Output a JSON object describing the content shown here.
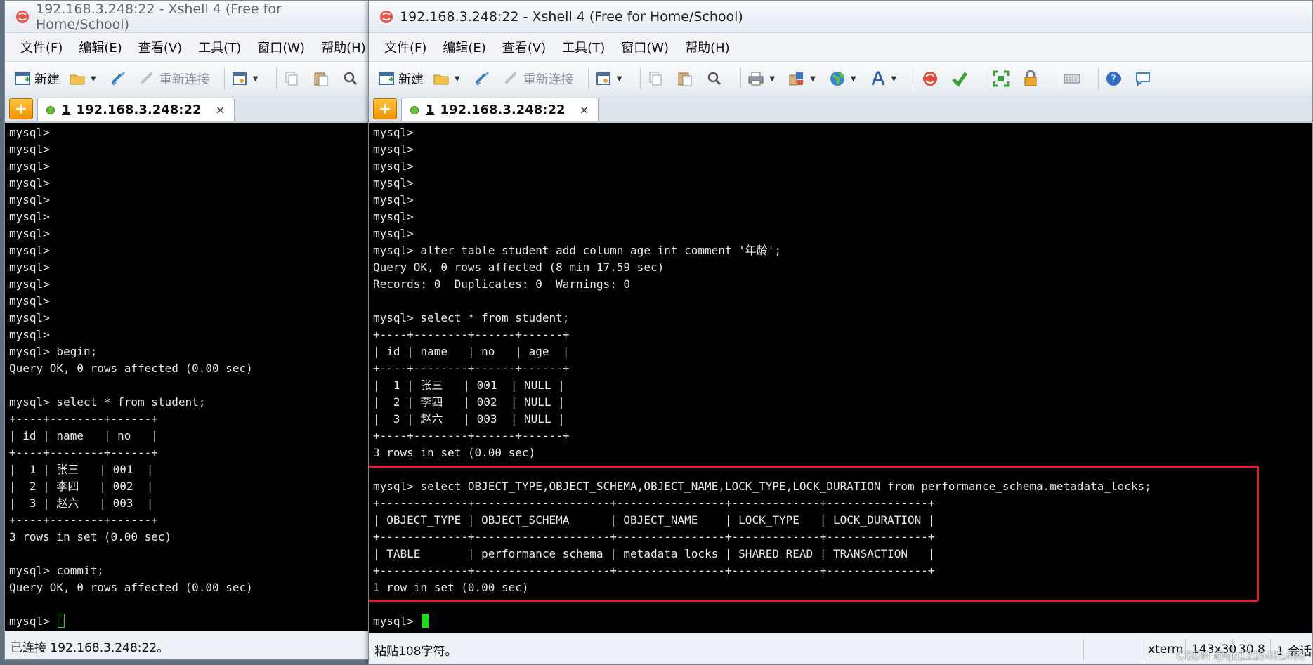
{
  "left_window": {
    "title": "192.168.3.248:22 - Xshell 4 (Free for Home/School)",
    "menu": [
      "文件(F)",
      "编辑(E)",
      "查看(V)",
      "工具(T)",
      "窗口(W)",
      "帮助(H)"
    ],
    "toolbar": {
      "new_label": "新建",
      "reconnect_label": "重新连接"
    },
    "tab": {
      "number": "1",
      "label": "192.168.3.248:22",
      "close": "×",
      "add": "+"
    },
    "terminal_lines": [
      "mysql>",
      "mysql>",
      "mysql>",
      "mysql>",
      "mysql>",
      "mysql>",
      "mysql>",
      "mysql>",
      "mysql>",
      "mysql>",
      "mysql>",
      "mysql>",
      "mysql>",
      "mysql> begin;",
      "Query OK, 0 rows affected (0.00 sec)",
      "",
      "mysql> select * from student;",
      "+----+--------+------+",
      "| id | name   | no   |",
      "+----+--------+------+",
      "|  1 | 张三   | 001  |",
      "|  2 | 李四   | 002  |",
      "|  3 | 赵六   | 003  |",
      "+----+--------+------+",
      "3 rows in set (0.00 sec)",
      "",
      "mysql> commit;",
      "Query OK, 0 rows affected (0.00 sec)",
      ""
    ],
    "prompt": "mysql>",
    "status": "已连接 192.168.3.248:22。"
  },
  "right_window": {
    "title": "192.168.3.248:22 - Xshell 4 (Free for Home/School)",
    "menu": [
      "文件(F)",
      "编辑(E)",
      "查看(V)",
      "工具(T)",
      "窗口(W)",
      "帮助(H)"
    ],
    "toolbar": {
      "new_label": "新建",
      "reconnect_label": "重新连接"
    },
    "tab": {
      "number": "1",
      "label": "192.168.3.248:22",
      "close": "×",
      "add": "+"
    },
    "terminal_lines": [
      "mysql>",
      "mysql>",
      "mysql>",
      "mysql>",
      "mysql>",
      "mysql>",
      "mysql>",
      "mysql> alter table student add column age int comment '年龄';",
      "Query OK, 0 rows affected (8 min 17.59 sec)",
      "Records: 0  Duplicates: 0  Warnings: 0",
      "",
      "mysql> select * from student;",
      "+----+--------+------+------+",
      "| id | name   | no   | age  |",
      "+----+--------+------+------+",
      "|  1 | 张三   | 001  | NULL |",
      "|  2 | 李四   | 002  | NULL |",
      "|  3 | 赵六   | 003  | NULL |",
      "+----+--------+------+------+",
      "3 rows in set (0.00 sec)",
      "",
      "mysql> select OBJECT_TYPE,OBJECT_SCHEMA,OBJECT_NAME,LOCK_TYPE,LOCK_DURATION from performance_schema.metadata_locks;",
      "+-------------+--------------------+----------------+-------------+---------------+",
      "| OBJECT_TYPE | OBJECT_SCHEMA      | OBJECT_NAME    | LOCK_TYPE   | LOCK_DURATION |",
      "+-------------+--------------------+----------------+-------------+---------------+",
      "| TABLE       | performance_schema | metadata_locks | SHARED_READ | TRANSACTION   |",
      "+-------------+--------------------+----------------+-------------+---------------+",
      "1 row in set (0.00 sec)",
      ""
    ],
    "prompt": "mysql>",
    "status": "粘贴108字符。",
    "status_term": "xterm",
    "status_size": "143x30",
    "status_pos": "30,8",
    "status_sessions": "1 会话"
  },
  "watermark": "CSDN @qq1215461468",
  "colors": {
    "terminal_bg": "#000000",
    "terminal_fg": "#e9e9e9",
    "cursor": "#1fdc1f",
    "highlight": "#e5202a"
  }
}
